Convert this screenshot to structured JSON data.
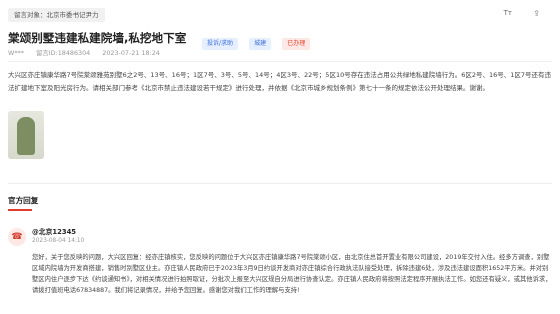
{
  "header": {
    "recipient": "留言对象：北京市委书记尹力",
    "font_toggle": "Tт",
    "share_icon": "share-icon"
  },
  "post": {
    "title": "棠颂别墅违建私建院墙,私挖地下室",
    "tags": [
      "投诉/求助",
      "城建",
      "已办理"
    ],
    "author": "W***",
    "message_id": "留言ID:18486304",
    "timestamp": "2023-07-21 18:24",
    "content": "大兴区亦庄镇康华路7号院棠颂雅苑别墅6之2号、13号、16号；1区7号、3号、5号、14号；4区3号、22号；5区10号存在违法占用公共绿地私建院墙行为。6区2号、16号、1区7号还有违法扩建地下室及阳光房行为。请相关部门参考《北京市禁止违法建设若干规定》进行处理，并依据《北京市城乡规划条例》第七十一条的规定依法公开处理结果。谢谢。"
  },
  "official": {
    "section_title": "官方回复",
    "org": "@北京12345",
    "time": "2023-08-04 14:10",
    "body": "您好，关于您反映的问题，大兴区回复：经亦庄镇核实，您反映的问题位于大兴区亦庄镇康华路7号院棠颂小区，由北京住总首开置业有限公司建设，2019年交付入住。经多方调查，别墅区域内院墙为开发商搭建，销售时别墅区业主。亦庄镇人民政府已于2023年3月9日约谈开发商对亦庄镇综合行政执法队接受处理，拆除违建6处，涉及违法建设面积1652平方米。并对别墅区内住户逐步下达《约谈通知书》，对相关情况进行拍照取证，分批次上报至大兴区规自分局进行协查认定。亦庄镇人民政府将按照法定程序开展执法工作。如您还有疑义，或其他诉求，请拨打值班电话67834887。我们将记录情况，并给予您回复。感谢您对我们工作的理解与支持!"
  },
  "colors": {
    "accent_red": "#e23b2b",
    "tag_blue_bg": "#e6efff",
    "tag_blue_text": "#3d6fd8",
    "tag_red_bg": "#fde8e6"
  }
}
